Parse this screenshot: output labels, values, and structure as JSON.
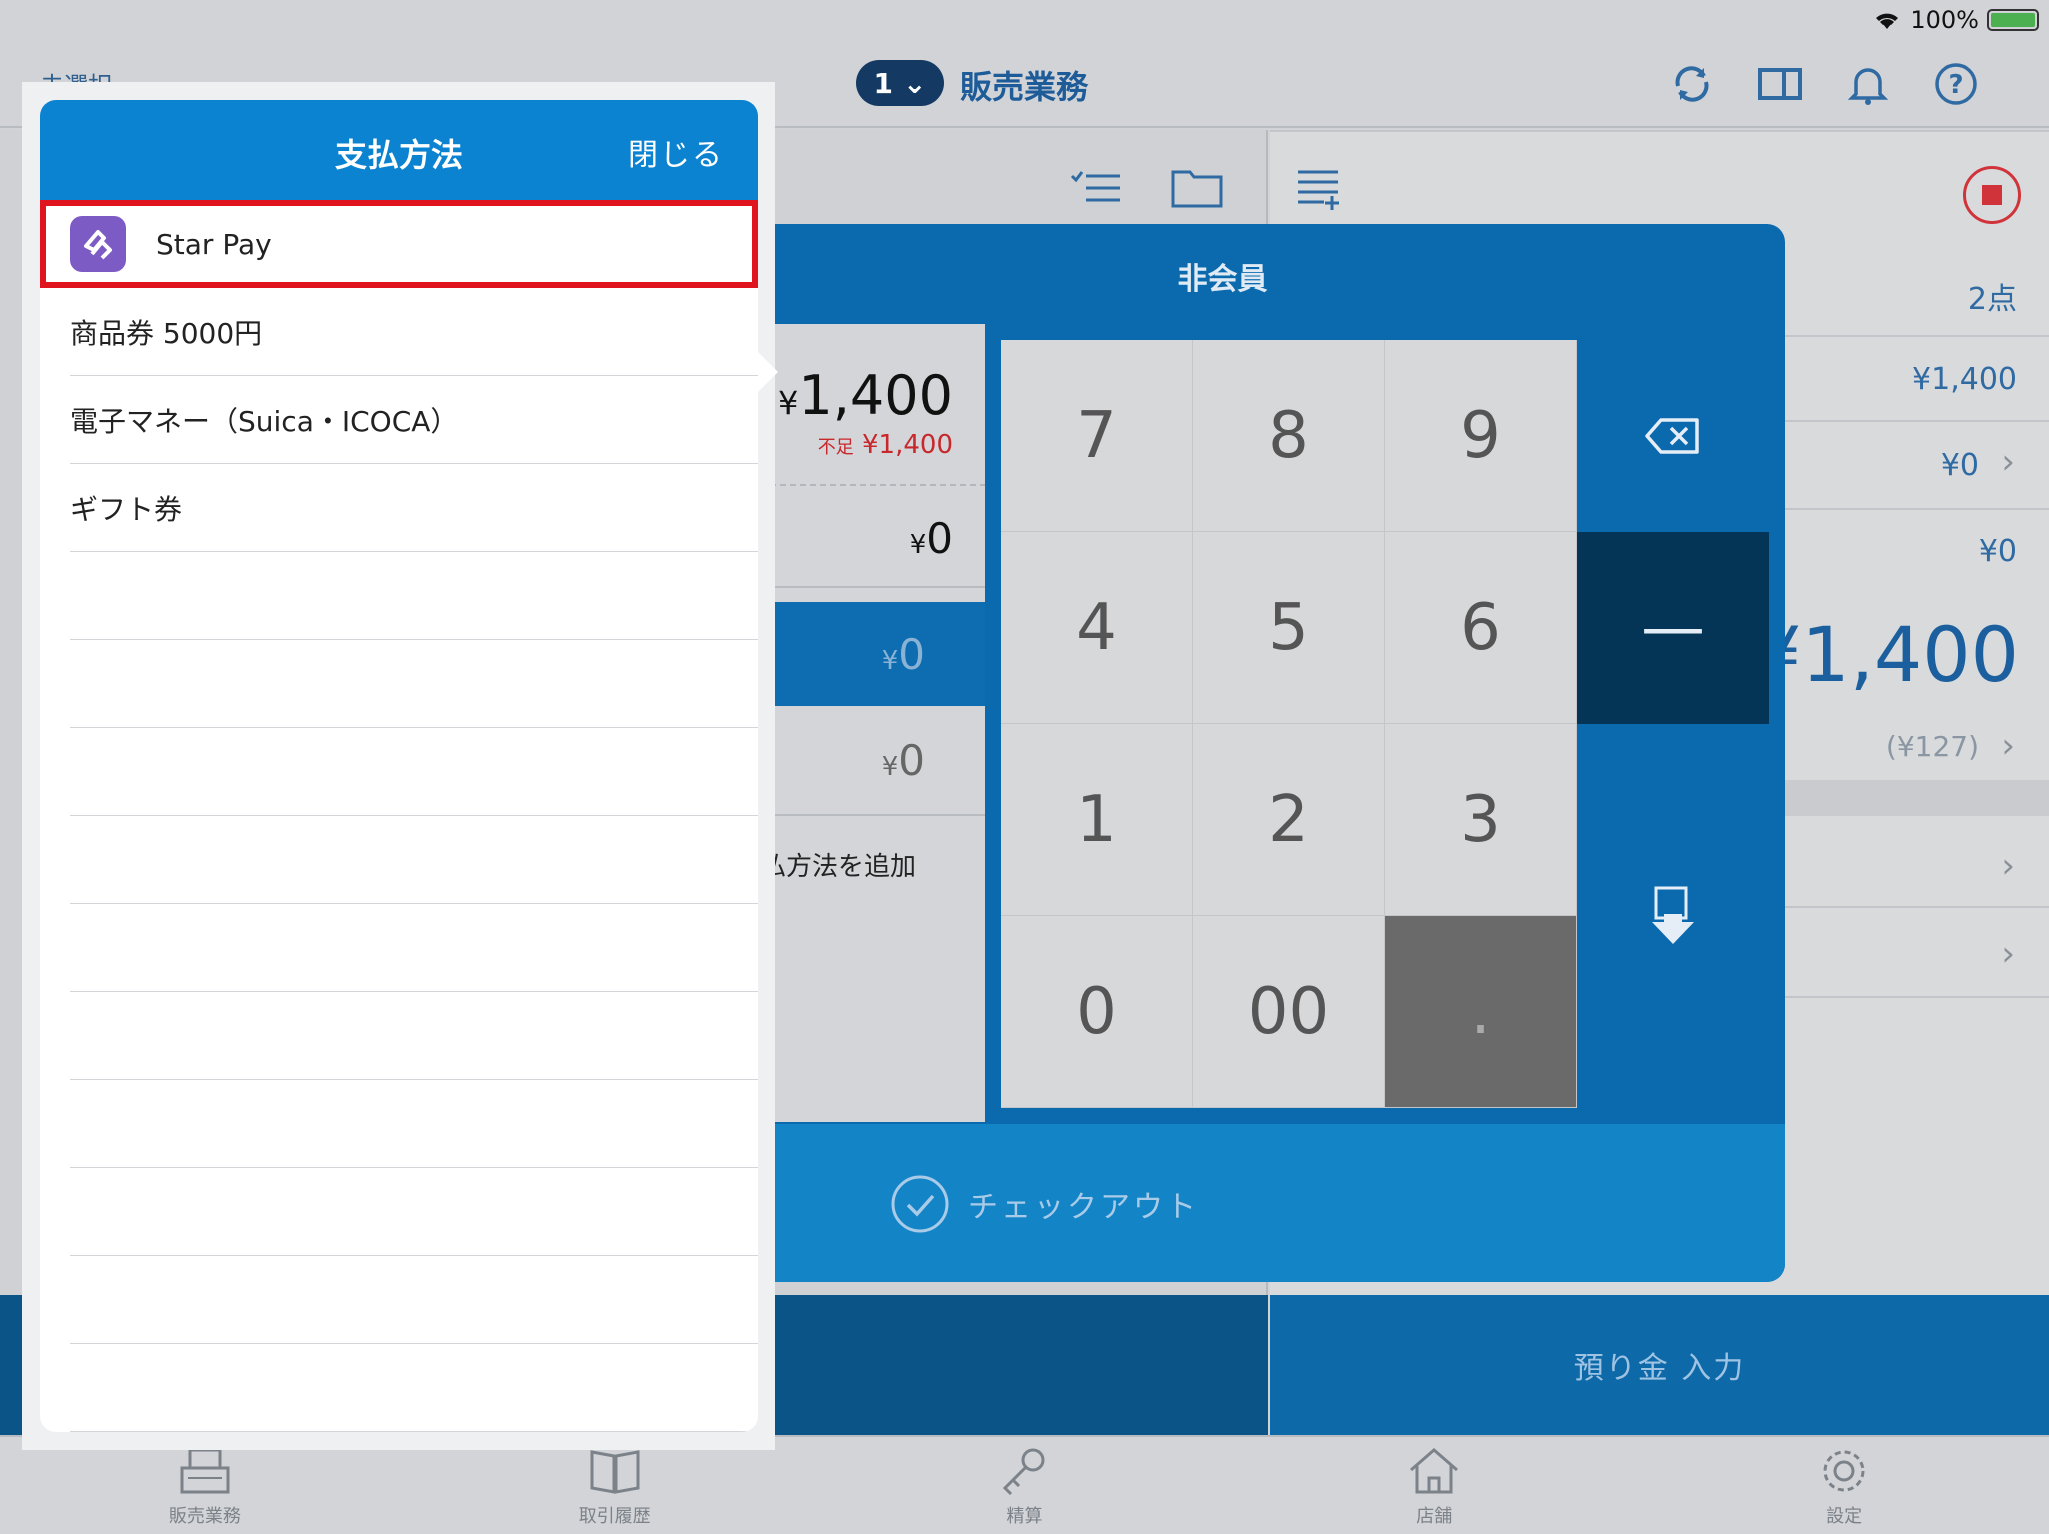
{
  "status": {
    "battery": "100%"
  },
  "top": {
    "customer_select": "未選択",
    "register_no": "1",
    "title": "販売業務"
  },
  "right": {
    "count": "2点",
    "subtotal": "¥1,400",
    "row2": "¥0",
    "row3": "¥0",
    "total": "¥1,400",
    "tax": "(¥127)"
  },
  "deposit_label": "預り金 入力",
  "payment": {
    "title": "非会員",
    "amount": "1,400",
    "shortage_label": "不足",
    "shortage_value": "¥1,400",
    "change": "0",
    "selected_value": "0",
    "second_value": "0",
    "add_method": "払方法を追加",
    "keys": [
      "7",
      "8",
      "9",
      "4",
      "5",
      "6",
      "1",
      "2",
      "3",
      "0",
      "00",
      "."
    ],
    "checkout": "チェックアウト",
    "currency": "¥"
  },
  "popover": {
    "title": "支払方法",
    "close": "閉じる",
    "items": [
      "Star Pay",
      "商品券 5000円",
      "電子マネー（Suica・ICOCA）",
      "ギフト券"
    ]
  },
  "tabs": [
    {
      "label": "販売業務",
      "icon": "register-icon"
    },
    {
      "label": "取引履歴",
      "icon": "book-icon"
    },
    {
      "label": "精算",
      "icon": "key-icon"
    },
    {
      "label": "店舗",
      "icon": "home-icon"
    },
    {
      "label": "設定",
      "icon": "gear-icon"
    }
  ]
}
